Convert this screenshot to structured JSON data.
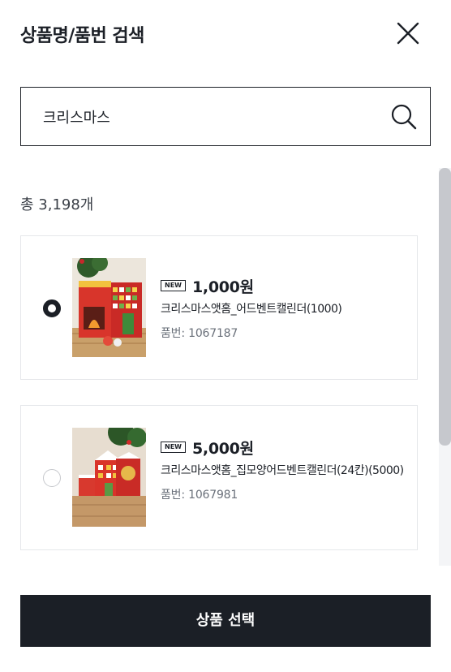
{
  "header": {
    "title": "상품명/품번 검색",
    "close_icon": "close-icon"
  },
  "search": {
    "value": "크리스마스",
    "placeholder": "",
    "search_icon": "search-icon"
  },
  "results": {
    "count_label": "총 3,198개",
    "items": [
      {
        "badge": "NEW",
        "price": "1,000원",
        "name": "크리스마스앳홈_어드벤트캘린더(1000)",
        "code": "품번: 1067187",
        "selected": true
      },
      {
        "badge": "NEW",
        "price": "5,000원",
        "name": "크리스마스앳홈_집모양어드벤트캘린더(24칸)(5000)",
        "code": "품번: 1067981",
        "selected": false
      }
    ]
  },
  "footer": {
    "select_label": "상품 선택"
  },
  "colors": {
    "primary": "#1b1f26",
    "border": "#e5e7ea",
    "muted_text": "#6a707a"
  }
}
